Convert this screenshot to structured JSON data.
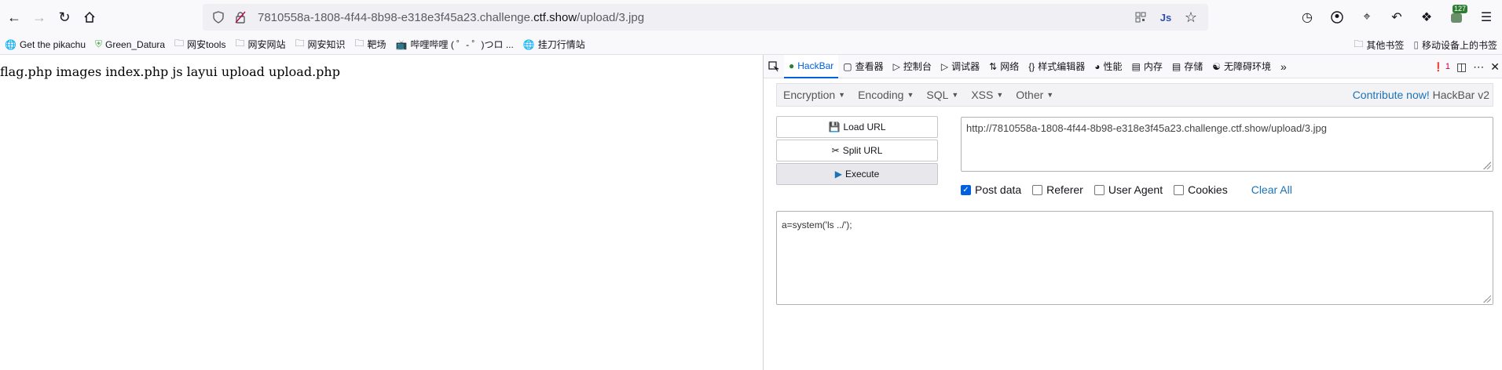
{
  "browser": {
    "url_prefix": "7810558a-1808-4f44-8b98-e318e3f45a23.challenge.",
    "url_domain": "ctf.show",
    "url_path": "/upload/3.jpg",
    "extension_badge": "127"
  },
  "bookmarks": {
    "items": [
      {
        "label": "Get the pikachu",
        "icon": "globe-icon"
      },
      {
        "label": "Green_Datura",
        "icon": "shield-icon"
      },
      {
        "label": "网安tools",
        "icon": "folder-icon"
      },
      {
        "label": "网安网站",
        "icon": "folder-icon"
      },
      {
        "label": "网安知识",
        "icon": "folder-icon"
      },
      {
        "label": "靶场",
        "icon": "folder-icon"
      },
      {
        "label": "哔哩哔哩 ( ゜- ゜)つロ ...",
        "icon": "bilibili-icon"
      },
      {
        "label": "挂刀行情站",
        "icon": "globe-icon"
      }
    ],
    "other": "其他书签",
    "mobile": "移动设备上的书签"
  },
  "page": {
    "listing": "flag.php images index.php js layui upload upload.php"
  },
  "devtools": {
    "tabs": [
      {
        "label": "HackBar",
        "active": true
      },
      {
        "label": "查看器"
      },
      {
        "label": "控制台"
      },
      {
        "label": "调试器"
      },
      {
        "label": "网络"
      },
      {
        "label": "样式编辑器"
      },
      {
        "label": "性能"
      },
      {
        "label": "内存"
      },
      {
        "label": "存储"
      },
      {
        "label": "无障碍环境"
      }
    ],
    "error_count": "1"
  },
  "hackbar": {
    "menu": [
      "Encryption",
      "Encoding",
      "SQL",
      "XSS",
      "Other"
    ],
    "contribute": "Contribute now!",
    "version": "HackBar v2",
    "load_url": "Load URL",
    "split_url": "Split URL",
    "execute": "Execute",
    "url_value": "http://7810558a-1808-4f44-8b98-e318e3f45a23.challenge.ctf.show/upload/3.jpg",
    "post_data_label": "Post data",
    "referer_label": "Referer",
    "user_agent_label": "User Agent",
    "cookies_label": "Cookies",
    "clear_all": "Clear All",
    "post_data_checked": true,
    "post_body": "a=system('ls ../');"
  }
}
